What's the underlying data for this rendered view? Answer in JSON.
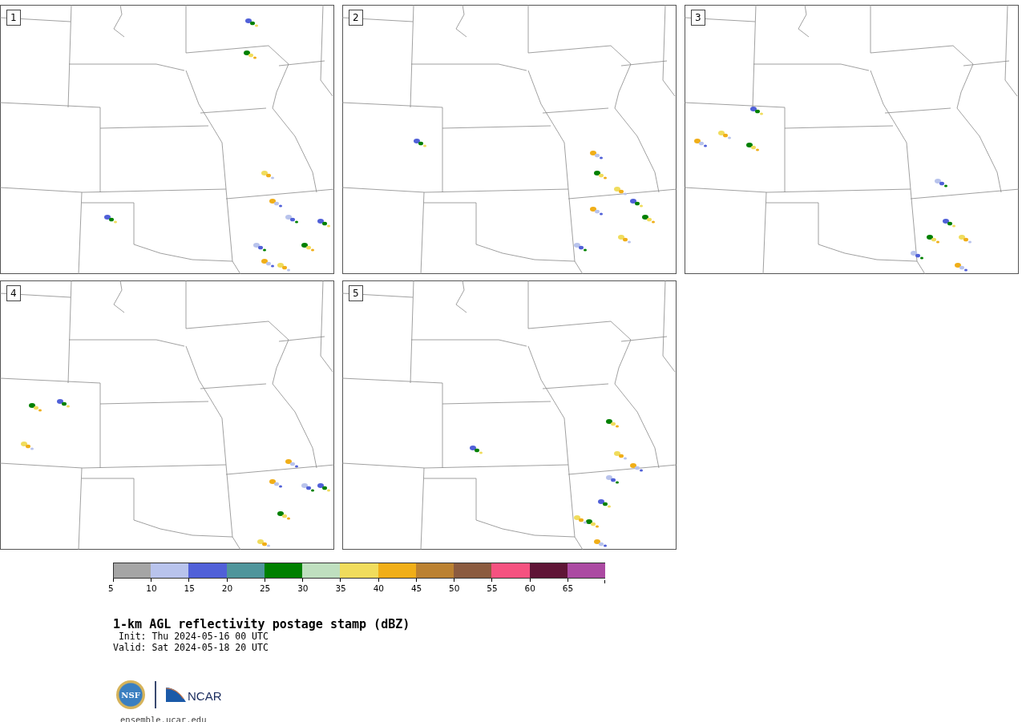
{
  "panels": [
    {
      "number": "1"
    },
    {
      "number": "2"
    },
    {
      "number": "3"
    },
    {
      "number": "4"
    },
    {
      "number": "5"
    }
  ],
  "colorbar": {
    "segments": [
      {
        "color": "#a5a5a5",
        "tick": "5"
      },
      {
        "color": "#b8c3ec",
        "tick": "10"
      },
      {
        "color": "#5060d8",
        "tick": "15"
      },
      {
        "color": "#4f959b",
        "tick": "20"
      },
      {
        "color": "#008000",
        "tick": "25"
      },
      {
        "color": "#bfdfbf",
        "tick": "30"
      },
      {
        "color": "#f0dc5c",
        "tick": "35"
      },
      {
        "color": "#f0ae18",
        "tick": "40"
      },
      {
        "color": "#bb8131",
        "tick": "45"
      },
      {
        "color": "#8b5b3f",
        "tick": "50"
      },
      {
        "color": "#f55280",
        "tick": "55"
      },
      {
        "color": "#5f1536",
        "tick": "60"
      },
      {
        "color": "#ab4aa2",
        "tick": "65"
      }
    ]
  },
  "title": "1-km AGL reflectivity postage stamp (dBZ)",
  "init": " Init: Thu 2024-05-16 00 UTC",
  "valid": "Valid: Sat 2024-05-18 20 UTC",
  "logos": {
    "nsf": "NSF",
    "ncar": "NCAR"
  },
  "site": "ensemble.ucar.edu"
}
